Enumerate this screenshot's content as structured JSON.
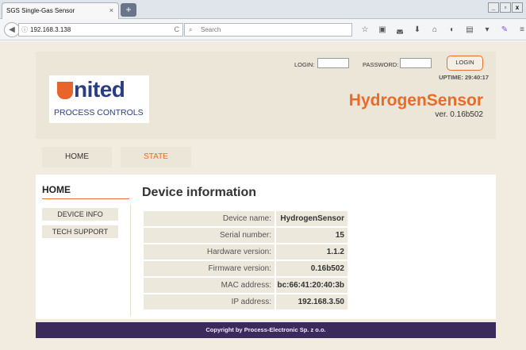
{
  "browser": {
    "tab_title": "SGS Single-Gas Sensor",
    "tab_close": "×",
    "new_tab": "+",
    "window_buttons": [
      "_",
      "▫",
      "x"
    ],
    "back": "◀",
    "url_info": "ⓘ",
    "url": "192.168.3.138",
    "reload": "C",
    "search_icon": "🔍",
    "search_placeholder": "Search",
    "toolbar_icons": [
      "star-icon",
      "clipboard-icon",
      "pocket-icon",
      "download-icon",
      "home-icon",
      "extension-icon",
      "reader-icon",
      "dropdown-icon",
      "pen-icon",
      "menu-icon"
    ]
  },
  "header": {
    "logo_word": "nited",
    "logo_sub": "PROCESS CONTROLS",
    "login_label": "LOGIN:",
    "password_label": "PASSWORD:",
    "login_button": "LOGIN",
    "uptime": "UPTIME: 29:40:17",
    "product_name": "HydrogenSensor",
    "product_version": "ver. 0.16b502"
  },
  "nav": {
    "home": "HOME",
    "state": "STATE"
  },
  "sidebar": {
    "title": "HOME",
    "items": [
      "DEVICE INFO",
      "TECH SUPPORT"
    ]
  },
  "main": {
    "title": "Device information",
    "rows": [
      {
        "label": "Device name:",
        "value": "HydrogenSensor"
      },
      {
        "label": "Serial number:",
        "value": "15"
      },
      {
        "label": "Hardware version:",
        "value": "1.1.2"
      },
      {
        "label": "Firmware version:",
        "value": "0.16b502"
      },
      {
        "label": "MAC address:",
        "value": "bc:66:41:20:40:3b"
      },
      {
        "label": "IP address:",
        "value": "192.168.3.50"
      }
    ]
  },
  "footer": {
    "copyright": "Copyright by Process-Electronic Sp. z o.o."
  },
  "colors": {
    "accent_orange": "#ec6a27",
    "brand_blue": "#2a3d82",
    "footer_purple": "#3b2a5c",
    "panel_beige": "#ebe6d7"
  }
}
